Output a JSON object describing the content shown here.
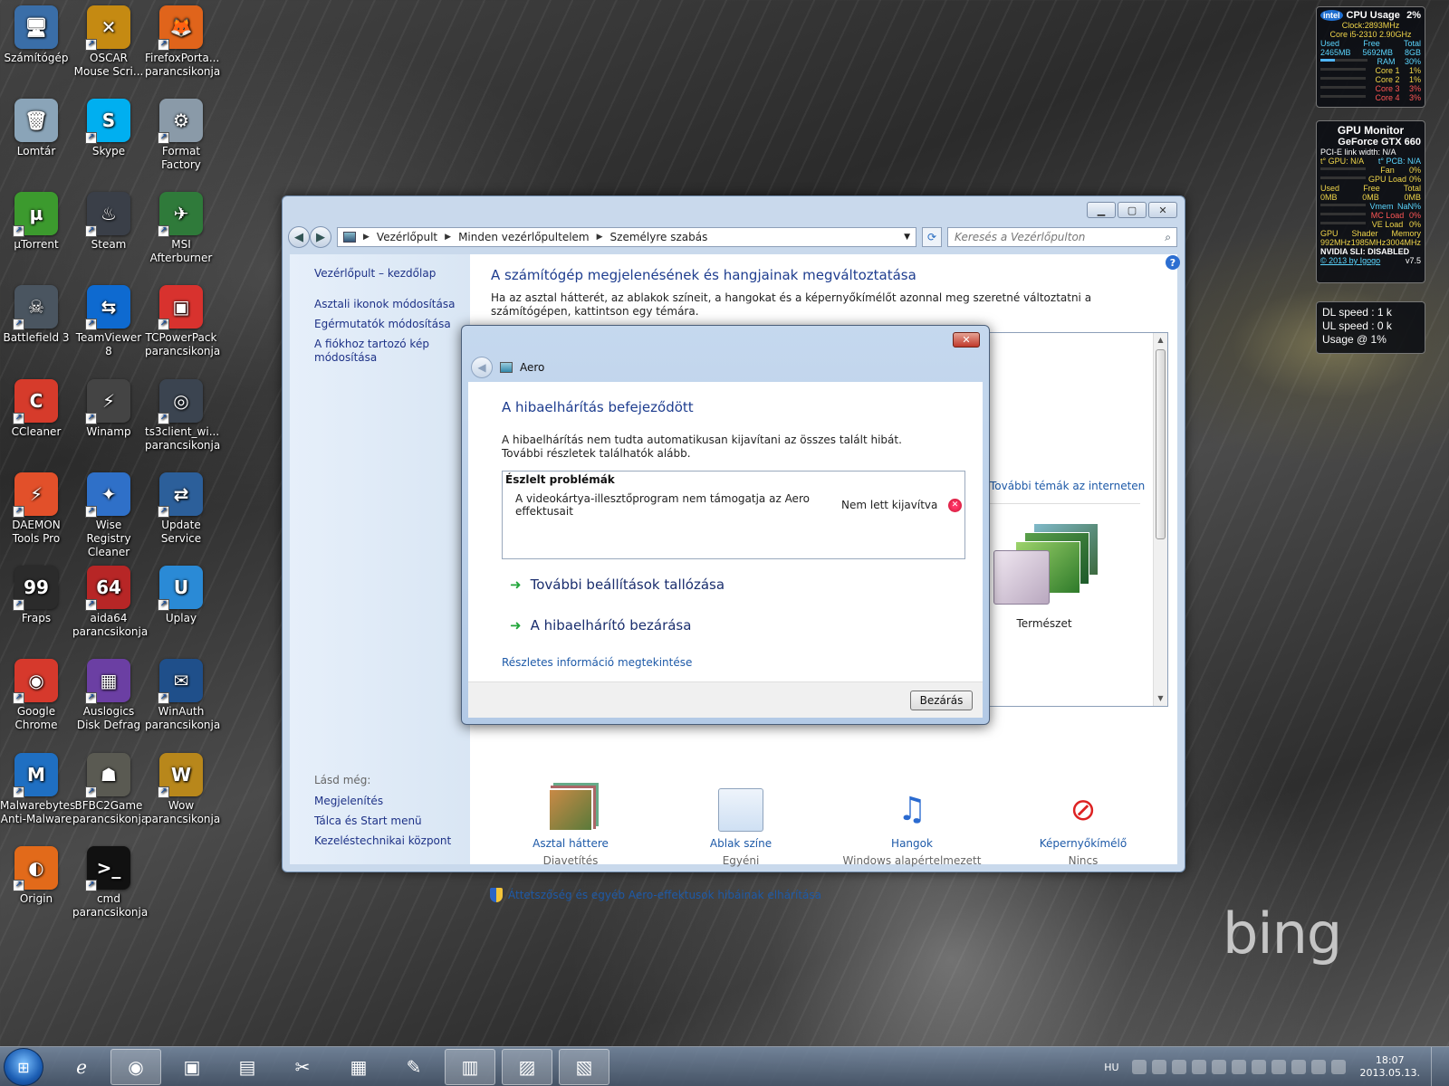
{
  "desktop": {
    "icons": [
      {
        "label": "Számítógép",
        "glyph": "🖥",
        "color": "#3a6ea8"
      },
      {
        "label": "OSCAR Mouse Scri...",
        "glyph": "✕",
        "color": "#c58a12"
      },
      {
        "label": "FirefoxPorta... parancsikonja",
        "glyph": "🦊",
        "color": "#e0641b"
      },
      {
        "label": "Lomtár",
        "glyph": "🗑",
        "color": "#8aa4b8"
      },
      {
        "label": "Skype",
        "glyph": "S",
        "color": "#00aff0"
      },
      {
        "label": "Format Factory",
        "glyph": "⚙",
        "color": "#8a9aa8"
      },
      {
        "label": "µTorrent",
        "glyph": "µ",
        "color": "#3c9a2e"
      },
      {
        "label": "Steam",
        "glyph": "♨",
        "color": "#3a3f48"
      },
      {
        "label": "MSI Afterburner",
        "glyph": "✈",
        "color": "#2f7a3a"
      },
      {
        "label": "Battlefield 3",
        "glyph": "☠",
        "color": "#4a5560"
      },
      {
        "label": "TeamViewer 8",
        "glyph": "⇆",
        "color": "#0e6ad0"
      },
      {
        "label": "TCPowerPack parancsikonja",
        "glyph": "▣",
        "color": "#d8322e"
      },
      {
        "label": "CCleaner",
        "glyph": "C",
        "color": "#d63b2b"
      },
      {
        "label": "Winamp",
        "glyph": "⚡",
        "color": "#444"
      },
      {
        "label": "ts3client_wi... parancsikonja",
        "glyph": "◎",
        "color": "#3b4450"
      },
      {
        "label": "DAEMON Tools Pro",
        "glyph": "⚡",
        "color": "#e2502a"
      },
      {
        "label": "Wise Registry Cleaner",
        "glyph": "✦",
        "color": "#2f70c8"
      },
      {
        "label": "Update Service",
        "glyph": "⇄",
        "color": "#2c5f9a"
      },
      {
        "label": "Fraps",
        "glyph": "99",
        "color": "#2b2b2b"
      },
      {
        "label": "aida64 parancsikonja",
        "glyph": "64",
        "color": "#b72626"
      },
      {
        "label": "Uplay",
        "glyph": "U",
        "color": "#2a8ad6"
      },
      {
        "label": "Google Chrome",
        "glyph": "◉",
        "color": "#d6392c"
      },
      {
        "label": "Auslogics Disk Defrag",
        "glyph": "▦",
        "color": "#6b3fa3"
      },
      {
        "label": "WinAuth parancsikonja",
        "glyph": "✉",
        "color": "#1f4f8a"
      },
      {
        "label": "Malwarebytes Anti-Malware",
        "glyph": "M",
        "color": "#1f6fc2"
      },
      {
        "label": "BFBC2Game parancsikonja",
        "glyph": "☗",
        "color": "#5a5a52"
      },
      {
        "label": "Wow parancsikonja",
        "glyph": "W",
        "color": "#b8871b"
      },
      {
        "label": "Origin",
        "glyph": "◐",
        "color": "#e26a1a"
      },
      {
        "label": "cmd parancsikonja",
        "glyph": ">_",
        "color": "#111"
      }
    ]
  },
  "gadgets": {
    "cpu": {
      "brand": "intel",
      "title": "CPU Usage",
      "usage": "2%",
      "clock": "Clock:2893MHz",
      "model": "Core i5-2310 2.90GHz",
      "mem_headers": [
        "Used",
        "Free",
        "Total"
      ],
      "mem_values": [
        "2465MB",
        "5692MB",
        "8GB"
      ],
      "ram_label": "RAM",
      "ram_pct": "30%",
      "ram_fraction": 0.3,
      "cores": [
        {
          "label": "Core 1",
          "value": "1%"
        },
        {
          "label": "Core 2",
          "value": "1%"
        },
        {
          "label": "Core 3",
          "value": "3%"
        },
        {
          "label": "Core 4",
          "value": "3%"
        }
      ]
    },
    "gpu": {
      "title": "GPU Monitor",
      "card": "GeForce GTX 660",
      "pcie": "PCI-E link width: N/A",
      "temp_gpu": "t° GPU: N/A",
      "temp_pcb": "t° PCB: N/A",
      "rows1": [
        {
          "label": "Fan",
          "value": "0%"
        },
        {
          "label": "GPU Load",
          "value": "0%"
        }
      ],
      "mem_headers": [
        "Used",
        "Free",
        "Total"
      ],
      "mem_values": [
        "0MB",
        "0MB",
        "0MB"
      ],
      "rows2": [
        {
          "label": "Vmem",
          "value": "NaN%"
        },
        {
          "label": "MC Load",
          "value": "0%"
        },
        {
          "label": "VE Load",
          "value": "0%"
        }
      ],
      "clock_headers": [
        "GPU",
        "Shader",
        "Memory"
      ],
      "clock_values": [
        "992MHz",
        "1985MHz",
        "3004MHz"
      ],
      "sli": "NVIDIA SLI: DISABLED",
      "copyright": "© 2013 by Igogo",
      "version": "v7.5"
    },
    "net": {
      "dl": "DL speed : 1 k",
      "ul": "UL speed : 0 k",
      "usage": "Usage @ 1%"
    }
  },
  "control_panel": {
    "breadcrumb": [
      "Vezérlőpult",
      "Minden vezérlőpultelem",
      "Személyre szabás"
    ],
    "search_placeholder": "Keresés a Vezérlőpulton",
    "left_home": "Vezérlőpult – kezdőlap",
    "left_links": [
      "Asztali ikonok módosítása",
      "Egérmutatók módosítása",
      "A fiókhoz tartozó kép módosítása"
    ],
    "see_also_label": "Lásd még:",
    "see_also": [
      "Megjelenítés",
      "Tálca és Start menü",
      "Kezeléstechnikai központ"
    ],
    "title": "A számítógép megjelenésének és hangjainak megváltoztatása",
    "description": "Ha az asztal hátterét, az ablakok színeit, a hangokat és a képernyőkímélőt azonnal meg szeretné változtatni a számítógépen, kattintson egy témára.",
    "more_themes": "További témák az interneten",
    "theme_name": "Természet",
    "bottom_items": [
      {
        "title": "Asztal háttere",
        "subtitle": "Diavetítés"
      },
      {
        "title": "Ablak színe",
        "subtitle": "Egyéni"
      },
      {
        "title": "Hangok",
        "subtitle": "Windows alapértelmezett"
      },
      {
        "title": "Képernyőkímélő",
        "subtitle": "Nincs"
      }
    ],
    "aero_link": "Áttetszőség és egyéb Aero-effektusok hibáinak elhárítása"
  },
  "dialog": {
    "window_title": "Aero",
    "heading": "A hibaelhárítás befejeződött",
    "text": "A hibaelhárítás nem tudta automatikusan kijavítani az összes talált hibát. További részletek találhatók alább.",
    "problems_header": "Észlelt problémák",
    "problems": [
      {
        "name": "A videokártya-illesztőprogram nem támogatja az Aero effektusait",
        "status": "Nem lett kijavítva"
      }
    ],
    "link_more": "További beállítások tallózása",
    "link_close": "A hibaelhárító bezárása",
    "details": "Részletes információ megtekintése",
    "close_button": "Bezárás"
  },
  "wallpaper_brand": "bing",
  "taskbar": {
    "language": "HU",
    "time": "18:07",
    "date": "2013.05.13."
  }
}
